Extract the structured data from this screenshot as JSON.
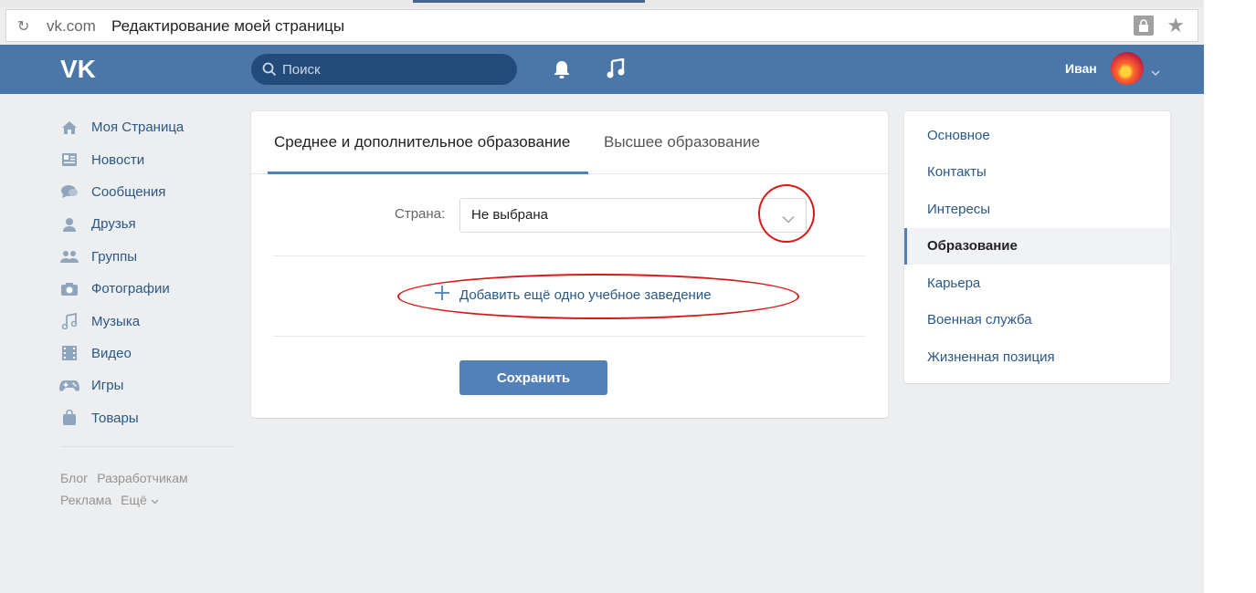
{
  "browser": {
    "domain": "vk.com",
    "page_title": "Редактирование моей страницы"
  },
  "header": {
    "search_placeholder": "Поиск",
    "user_name": "Иван"
  },
  "leftnav": {
    "items": [
      {
        "label": "Моя Страница",
        "icon": "home-icon"
      },
      {
        "label": "Новости",
        "icon": "news-icon"
      },
      {
        "label": "Сообщения",
        "icon": "messages-icon"
      },
      {
        "label": "Друзья",
        "icon": "friends-icon"
      },
      {
        "label": "Группы",
        "icon": "groups-icon"
      },
      {
        "label": "Фотографии",
        "icon": "camera-icon"
      },
      {
        "label": "Музыка",
        "icon": "music-icon"
      },
      {
        "label": "Видео",
        "icon": "video-icon"
      },
      {
        "label": "Игры",
        "icon": "games-icon"
      },
      {
        "label": "Товары",
        "icon": "bag-icon"
      }
    ],
    "footer": {
      "blog": "Блог",
      "developers": "Разработчикам",
      "ads": "Реклама",
      "more": "Ещё"
    }
  },
  "main": {
    "tabs": [
      {
        "label": "Среднее и дополнительное образование",
        "active": true
      },
      {
        "label": "Высшее образование",
        "active": false
      }
    ],
    "country_label": "Страна:",
    "country_value": "Не выбрана",
    "add_link": "Добавить ещё одно учебное заведение",
    "save_label": "Сохранить"
  },
  "rightmenu": {
    "items": [
      {
        "label": "Основное"
      },
      {
        "label": "Контакты"
      },
      {
        "label": "Интересы"
      },
      {
        "label": "Образование",
        "active": true
      },
      {
        "label": "Карьера"
      },
      {
        "label": "Военная служба"
      },
      {
        "label": "Жизненная позиция"
      }
    ]
  },
  "colors": {
    "header": "#4a76a8",
    "link": "#2a5885",
    "button": "#5181b8",
    "annotation": "#d81818"
  }
}
